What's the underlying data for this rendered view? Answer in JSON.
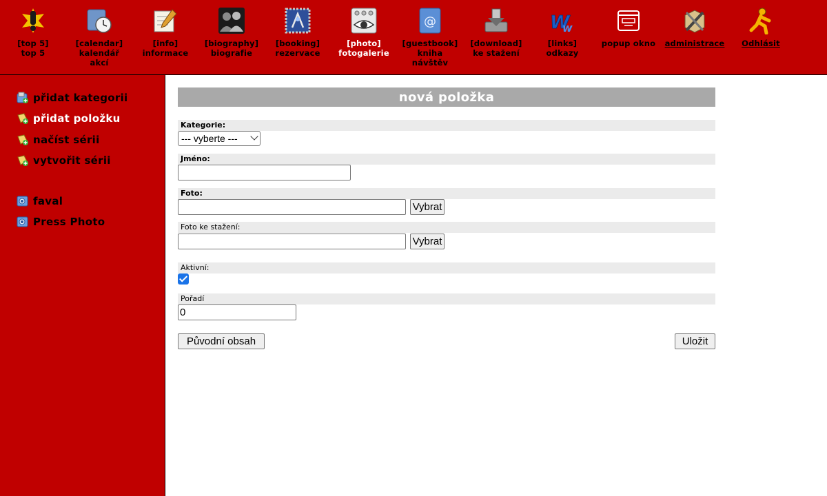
{
  "nav": {
    "items": [
      {
        "line1": "[top 5]",
        "line2": "top 5",
        "line3": "",
        "icon": "exclamation-bomb-icon"
      },
      {
        "line1": "[calendar]",
        "line2": "kalendář",
        "line3": "akcí",
        "icon": "calendar-clock-icon"
      },
      {
        "line1": "[info]",
        "line2": "informace",
        "line3": "",
        "icon": "notepad-pencil-icon"
      },
      {
        "line1": "[biography]",
        "line2": "biografie",
        "line3": "",
        "icon": "people-silhouettes-icon"
      },
      {
        "line1": "[booking]",
        "line2": "rezervace",
        "line3": "",
        "icon": "stamp-icon"
      },
      {
        "line1": "[photo]",
        "line2": "fotogalerie",
        "line3": "",
        "icon": "eye-preview-icon"
      },
      {
        "line1": "[guestbook]",
        "line2": "kniha",
        "line3": "návštěv",
        "icon": "address-book-icon"
      },
      {
        "line1": "[download]",
        "line2": "ke stažení",
        "line3": "",
        "icon": "download-tray-icon"
      },
      {
        "line1": "[links]",
        "line2": "odkazy",
        "line3": "",
        "icon": "www-links-icon"
      },
      {
        "line1": "popup okno",
        "line2": "",
        "line3": "",
        "icon": "popup-window-icon"
      },
      {
        "line1": "administrace",
        "line2": "",
        "line3": "",
        "icon": "admin-tools-icon"
      },
      {
        "line1": "Odhlásit",
        "line2": "",
        "line3": "",
        "icon": "running-man-icon"
      }
    ],
    "active_index": 5
  },
  "sidebar": {
    "items": [
      {
        "label": "přidat kategorii",
        "icon": "add-category-icon"
      },
      {
        "label": "přidat položku",
        "icon": "add-item-icon"
      },
      {
        "label": "načíst sérii",
        "icon": "load-series-icon"
      },
      {
        "label": "vytvořit sérii",
        "icon": "create-series-icon"
      },
      {
        "label": "faval",
        "icon": "gallery-icon"
      },
      {
        "label": "Press Photo",
        "icon": "gallery-icon"
      }
    ]
  },
  "form": {
    "title": "nová položka",
    "kategorie_label": "Kategorie:",
    "kategorie_value": "--- vyberte ---",
    "jmeno_label": "Jméno:",
    "jmeno_value": "",
    "foto_label": "Foto:",
    "foto_value": "",
    "foto_button": "Vybrat",
    "foto_download_label": "Foto ke stažení:",
    "foto_download_value": "",
    "foto_download_button": "Vybrat",
    "aktivni_label": "Aktivní:",
    "aktivni_checked": true,
    "poradi_label": "Pořadí",
    "poradi_value": "0",
    "reset_button": "Původní obsah",
    "save_button": "Uložit"
  },
  "colors": {
    "brand_red": "#c00000",
    "title_bar": "#a9a9a9",
    "label_bg": "#ebebeb",
    "checkbox_blue": "#1a73e8"
  }
}
